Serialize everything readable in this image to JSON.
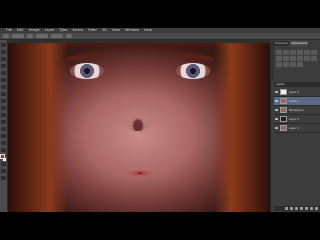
{
  "menubar": {
    "items": [
      "File",
      "Edit",
      "Image",
      "Layer",
      "Type",
      "Select",
      "Filter",
      "3D",
      "View",
      "Window",
      "Help"
    ]
  },
  "doc": {
    "tab_label": ""
  },
  "panels": {
    "tabs": [
      "Properties",
      "Adjustments"
    ],
    "layers_header": "Layers",
    "layers": [
      {
        "name": "Layer 2",
        "thumb": "white",
        "selected": false
      },
      {
        "name": "Layer 1",
        "thumb": "photo",
        "selected": true
      },
      {
        "name": "Background",
        "thumb": "photo",
        "selected": false
      },
      {
        "name": "Layer 3",
        "thumb": "dark",
        "selected": false
      },
      {
        "name": "Layer 4",
        "thumb": "photo",
        "selected": false
      }
    ]
  },
  "colors": {
    "foreground": "#b22222",
    "background": "#ffffff",
    "selection": "#5a6a84"
  },
  "icons": [
    "eye-icon",
    "link-icon",
    "fx-icon",
    "mask-icon",
    "adjustment-icon",
    "folder-icon",
    "new-layer-icon",
    "trash-icon"
  ]
}
